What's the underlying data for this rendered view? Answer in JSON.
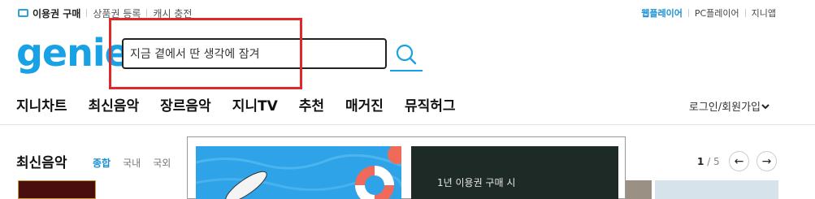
{
  "utility": {
    "ticket_label": "이용권 구매",
    "product_label": "상품권 등록",
    "cash_label": "캐시 충전",
    "web_player": "웹플레이어",
    "pc_player": "PC플레이어",
    "genie_app": "지니앱"
  },
  "logo": {
    "text": "genie"
  },
  "search": {
    "value": "지금 곁에서 딴 생각에 잠겨",
    "placeholder": ""
  },
  "nav": {
    "items": [
      "지니차트",
      "최신음악",
      "장르음악",
      "지니TV",
      "추천",
      "매거진",
      "뮤직허그"
    ],
    "login": "로그인/회원가입"
  },
  "section": {
    "title": "최신음악",
    "tabs": [
      "종합",
      "국내",
      "국외"
    ],
    "page_current": "1",
    "page_total": "5"
  },
  "popup": {
    "promo_text": "1년 이용권 구매 시"
  },
  "colors": {
    "accent": "#19a1e6",
    "highlight": "#e0282a"
  }
}
